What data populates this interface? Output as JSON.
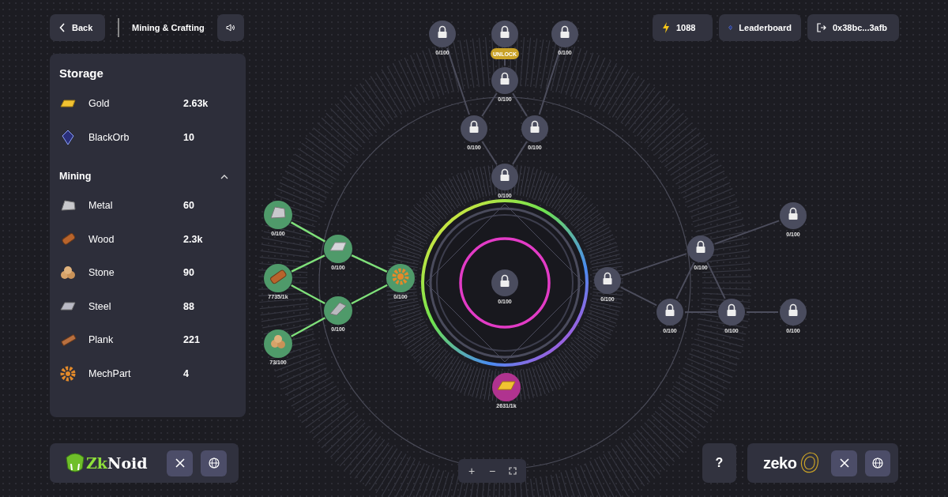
{
  "header": {
    "back": "Back",
    "title": "Mining & Crafting"
  },
  "top_right": {
    "energy": "1088",
    "leaderboard": "Leaderboard",
    "wallet": "0x38bc...3afb"
  },
  "storage": {
    "title": "Storage",
    "items": [
      {
        "name": "Gold",
        "amount": "2.63k"
      },
      {
        "name": "BlackOrb",
        "amount": "10"
      }
    ]
  },
  "mining": {
    "title": "Mining",
    "expanded": true,
    "items": [
      {
        "name": "Metal",
        "amount": "60"
      },
      {
        "name": "Wood",
        "amount": "2.3k"
      },
      {
        "name": "Stone",
        "amount": "90"
      },
      {
        "name": "Steel",
        "amount": "88"
      },
      {
        "name": "Plank",
        "amount": "221"
      },
      {
        "name": "MechPart",
        "amount": "4"
      }
    ]
  },
  "map": {
    "nodes": [
      {
        "kind": "locked",
        "label": "0/100"
      },
      {
        "kind": "locked",
        "badge": "UNLOCK"
      },
      {
        "kind": "locked",
        "label": "0/100"
      },
      {
        "kind": "locked",
        "label": "0/100"
      },
      {
        "kind": "locked",
        "label": "0/100"
      },
      {
        "kind": "locked",
        "label": "0/100"
      },
      {
        "kind": "locked",
        "label": "0/100"
      },
      {
        "kind": "locked",
        "label": "0/100"
      },
      {
        "kind": "locked",
        "label": "0/100"
      },
      {
        "kind": "locked",
        "label": "0/100"
      },
      {
        "kind": "locked",
        "label": "0/100"
      },
      {
        "kind": "locked",
        "label": "0/100"
      },
      {
        "kind": "locked",
        "label": "0/100"
      },
      {
        "kind": "locked",
        "label": "0/100"
      },
      {
        "kind": "resource",
        "label": "0/100",
        "color": "#4f9a6a"
      },
      {
        "kind": "resource",
        "label": "7735/1k",
        "color": "#4f9a6a"
      },
      {
        "kind": "resource",
        "label": "73/100",
        "color": "#4f9a6a"
      },
      {
        "kind": "resource",
        "label": "0/100",
        "color": "#4f9a6a"
      },
      {
        "kind": "resource",
        "label": "0/100",
        "color": "#4f9a6a"
      },
      {
        "kind": "resource",
        "label": "0/100",
        "color": "#4f9a6a"
      },
      {
        "kind": "resource",
        "label": "2631/1k",
        "color": "#b0338f"
      }
    ],
    "edges": [
      {
        "active": false
      },
      {
        "active": false
      },
      {
        "active": false
      },
      {
        "active": false
      },
      {
        "active": false
      },
      {
        "active": false
      },
      {
        "active": false
      },
      {
        "active": false
      },
      {
        "active": false
      },
      {
        "active": false
      },
      {
        "active": false
      },
      {
        "active": false
      },
      {
        "active": false
      },
      {
        "active": false
      },
      {
        "active": true
      },
      {
        "active": true
      },
      {
        "active": true
      },
      {
        "active": true
      },
      {
        "active": true
      },
      {
        "active": true
      }
    ]
  },
  "zoom_controls": [
    "+",
    "−"
  ],
  "help": "?",
  "footer_left": {
    "logo_parts": [
      "Zk",
      "Noid"
    ]
  },
  "footer_right": {
    "logo": "zeko"
  }
}
